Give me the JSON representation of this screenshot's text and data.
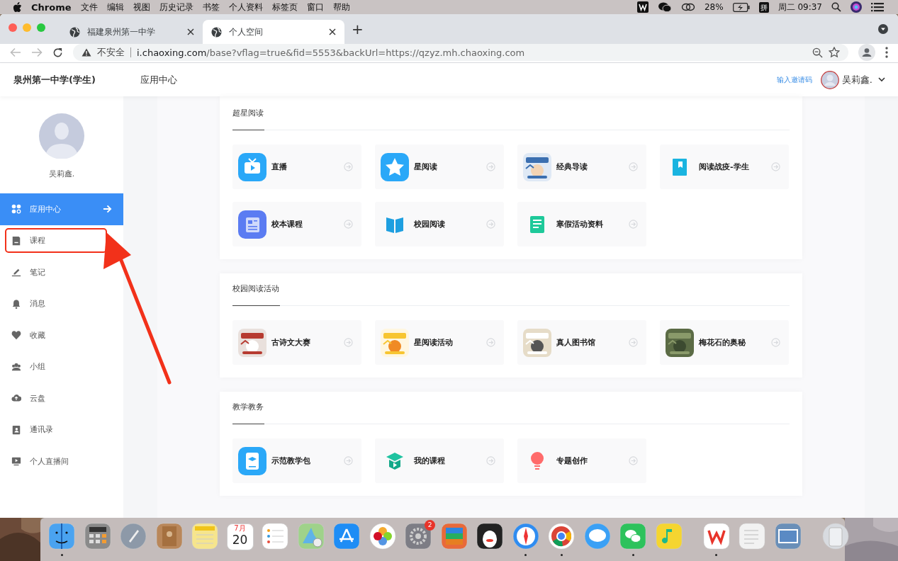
{
  "menubar": {
    "app": "Chrome",
    "menus": [
      "文件",
      "编辑",
      "视图",
      "历史记录",
      "书签",
      "个人资料",
      "标签页",
      "窗口",
      "帮助"
    ],
    "battery": "28%",
    "input_method": "拼",
    "clock": "周二 09:37"
  },
  "browser": {
    "tabs": [
      {
        "title": "福建泉州第一中学",
        "selected": false
      },
      {
        "title": "个人空间",
        "selected": true
      }
    ],
    "new_tab": "+",
    "security": "不安全",
    "url_host": "i.chaoxing.com",
    "url_path": "/base?vflag=true&fid=5553&backUrl=https://qzyz.mh.chaoxing.com"
  },
  "header": {
    "school": "泉州第一中学(学生)",
    "nav": "应用中心",
    "invite": "输入邀请码",
    "user": "吴莉鑫."
  },
  "sidebar": {
    "user": "吴莉鑫.",
    "items": [
      {
        "label": "应用中心",
        "selected": true,
        "highlighted": false
      },
      {
        "label": "课程",
        "selected": false,
        "highlighted": true
      },
      {
        "label": "笔记",
        "selected": false,
        "highlighted": false
      },
      {
        "label": "消息",
        "selected": false,
        "highlighted": false
      },
      {
        "label": "收藏",
        "selected": false,
        "highlighted": false
      },
      {
        "label": "小组",
        "selected": false,
        "highlighted": false
      },
      {
        "label": "云盘",
        "selected": false,
        "highlighted": false
      },
      {
        "label": "通讯录",
        "selected": false,
        "highlighted": false
      },
      {
        "label": "个人直播间",
        "selected": false,
        "highlighted": false
      }
    ]
  },
  "sections": [
    {
      "title": "超星阅读",
      "apps": [
        {
          "label": "直播",
          "kind": "icon"
        },
        {
          "label": "星阅读",
          "kind": "icon"
        },
        {
          "label": "经典导读",
          "kind": "picture"
        },
        {
          "label": "阅读战疫-学生",
          "kind": "icon"
        },
        {
          "label": "校本课程",
          "kind": "icon"
        },
        {
          "label": "校园阅读",
          "kind": "icon"
        },
        {
          "label": "寒假活动资料",
          "kind": "icon"
        }
      ]
    },
    {
      "title": "校园阅读活动",
      "apps": [
        {
          "label": "古诗文大赛",
          "kind": "picture"
        },
        {
          "label": "星阅读活动",
          "kind": "picture"
        },
        {
          "label": "真人图书馆",
          "kind": "picture"
        },
        {
          "label": "梅花石的奥秘",
          "kind": "picture"
        }
      ]
    },
    {
      "title": "教学教务",
      "apps": [
        {
          "label": "示范教学包",
          "kind": "icon"
        },
        {
          "label": "我的课程",
          "kind": "icon"
        },
        {
          "label": "专题创作",
          "kind": "icon"
        }
      ]
    }
  ],
  "dock": {
    "calendar_month": "7月",
    "calendar_day": "20",
    "badge": "2",
    "items": [
      {
        "running": true
      },
      {
        "running": false
      },
      {
        "running": false
      },
      {
        "running": false
      },
      {
        "running": false
      },
      {
        "running": false
      },
      {
        "running": false
      },
      {
        "running": false
      },
      {
        "running": false
      },
      {
        "running": false
      },
      {
        "running": false
      },
      {
        "running": false
      },
      {
        "running": false
      },
      {
        "running": true
      },
      {
        "running": true
      },
      {
        "running": false
      },
      {
        "running": true
      },
      {
        "running": false
      },
      {
        "running": true
      },
      {
        "running": false
      },
      {
        "running": false
      },
      {
        "running": false
      }
    ]
  }
}
